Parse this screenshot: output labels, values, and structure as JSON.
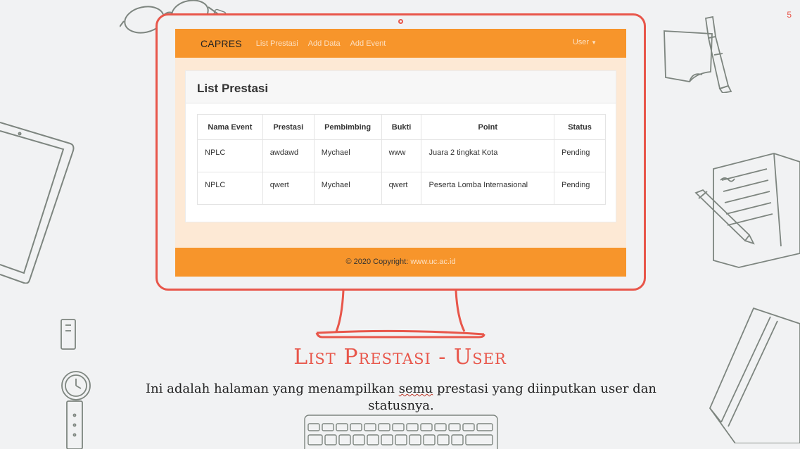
{
  "screen": {
    "navbar": {
      "brand": "CAPRES",
      "links": [
        "List Prestasi",
        "Add Data",
        "Add Event"
      ],
      "user_menu": "User"
    },
    "card": {
      "title": "List Prestasi",
      "table": {
        "headers": [
          "Nama Event",
          "Prestasi",
          "Pembimbing",
          "Bukti",
          "Point",
          "Status"
        ],
        "rows": [
          [
            "NPLC",
            "awdawd",
            "Mychael",
            "www",
            "Juara 2 tingkat Kota",
            "Pending"
          ],
          [
            "NPLC",
            "qwert",
            "Mychael",
            "qwert",
            "Peserta Lomba Internasional",
            "Pending"
          ]
        ]
      }
    },
    "footer": {
      "text": "© 2020 Copyright: ",
      "link": "www.uc.ac.id"
    }
  },
  "slide": {
    "title": "List Prestasi - User",
    "description_before": "Ini adalah halaman yang menampilkan ",
    "description_misspelled": "semu",
    "description_after": " prestasi yang diinputkan user dan statusnya.",
    "page_number": "5"
  },
  "colors": {
    "navbar": "#f7952b",
    "monitor_outline": "#e8564a",
    "status_pending": "#ffd84d",
    "screen_background": "#fde9d5"
  },
  "icons": [
    "glasses-icon",
    "usb-drive-icon",
    "tablet-icon",
    "sticky-note-icon",
    "marker-icon",
    "notebook-icon",
    "pen-icon",
    "wristwatch-icon",
    "book-icon",
    "keyboard-icon",
    "caret-down-icon"
  ]
}
